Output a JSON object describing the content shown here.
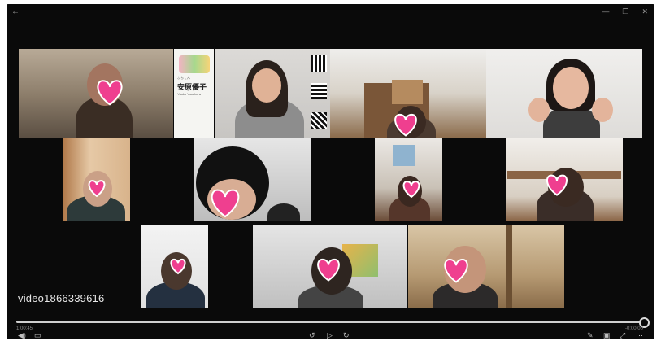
{
  "window": {
    "back_icon": "back-arrow-icon",
    "minimize_icon": "minimize-icon",
    "restore_icon": "restore-icon",
    "close_icon": "close-icon"
  },
  "video": {
    "label": "video1866339616",
    "progress": 1.0
  },
  "name_card": {
    "small_text": "ぷちてん",
    "jp_name": "安原優子",
    "en_name": "Yuuko Yasuhara"
  },
  "playback": {
    "elapsed": "1:00:45",
    "remaining": "-0:00:00"
  },
  "controls": {
    "left_a": "volume-icon",
    "left_b": "subtitles-icon",
    "center_a": "skip-back-icon",
    "center_b": "play-icon",
    "center_c": "skip-forward-icon",
    "right_a": "edit-icon",
    "right_b": "cast-icon",
    "right_c": "fullscreen-icon",
    "right_d": "more-icon"
  },
  "colors": {
    "heart": "#ef3f8f",
    "background": "#0a0a0a"
  }
}
